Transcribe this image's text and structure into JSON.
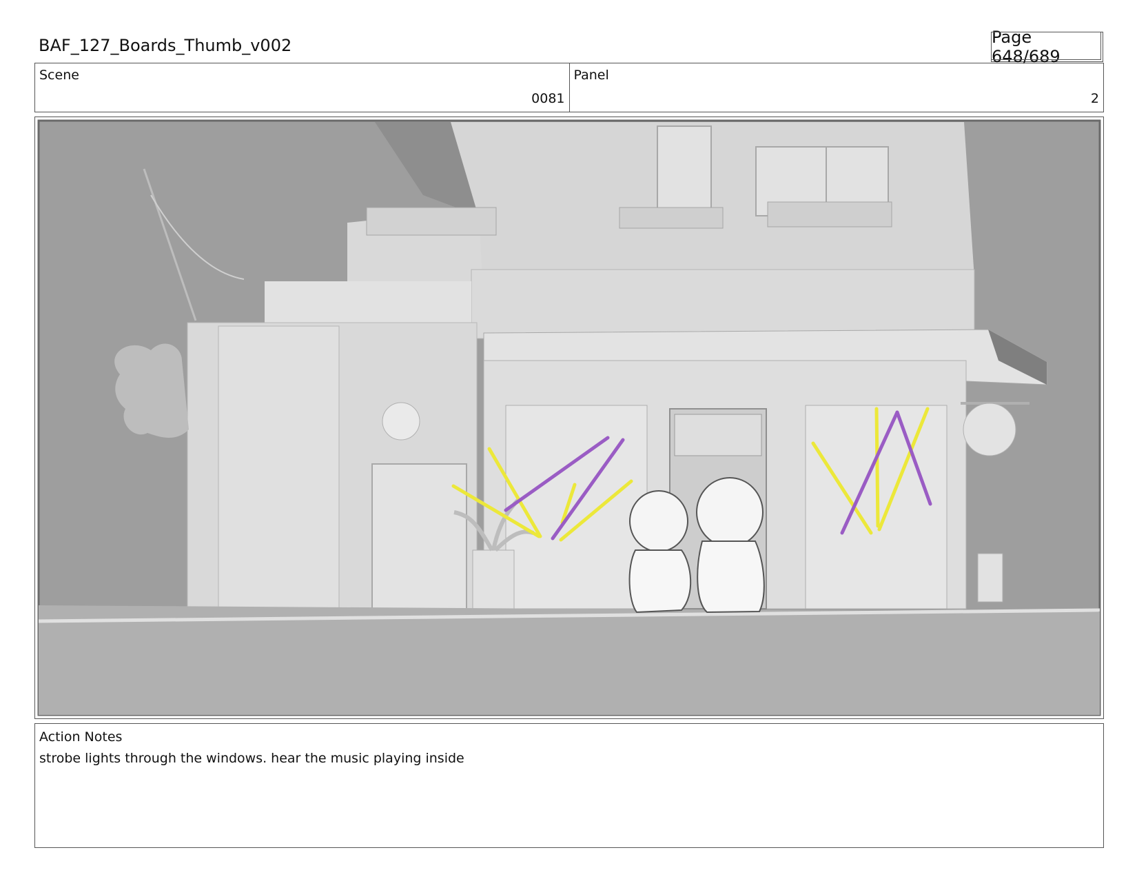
{
  "document": {
    "title": "BAF_127_Boards_Thumb_v002",
    "page": "Page 648/689"
  },
  "scene": {
    "label": "Scene",
    "value": "0081"
  },
  "panel": {
    "label": "Panel",
    "value": "2"
  },
  "action_notes": {
    "label": "Action Notes",
    "text": "strobe lights through the windows. hear the music playing inside"
  },
  "colors": {
    "strobe_yellow": "#ece83a",
    "strobe_purple": "#9a5cc4",
    "sky": "#9e9e9e"
  }
}
